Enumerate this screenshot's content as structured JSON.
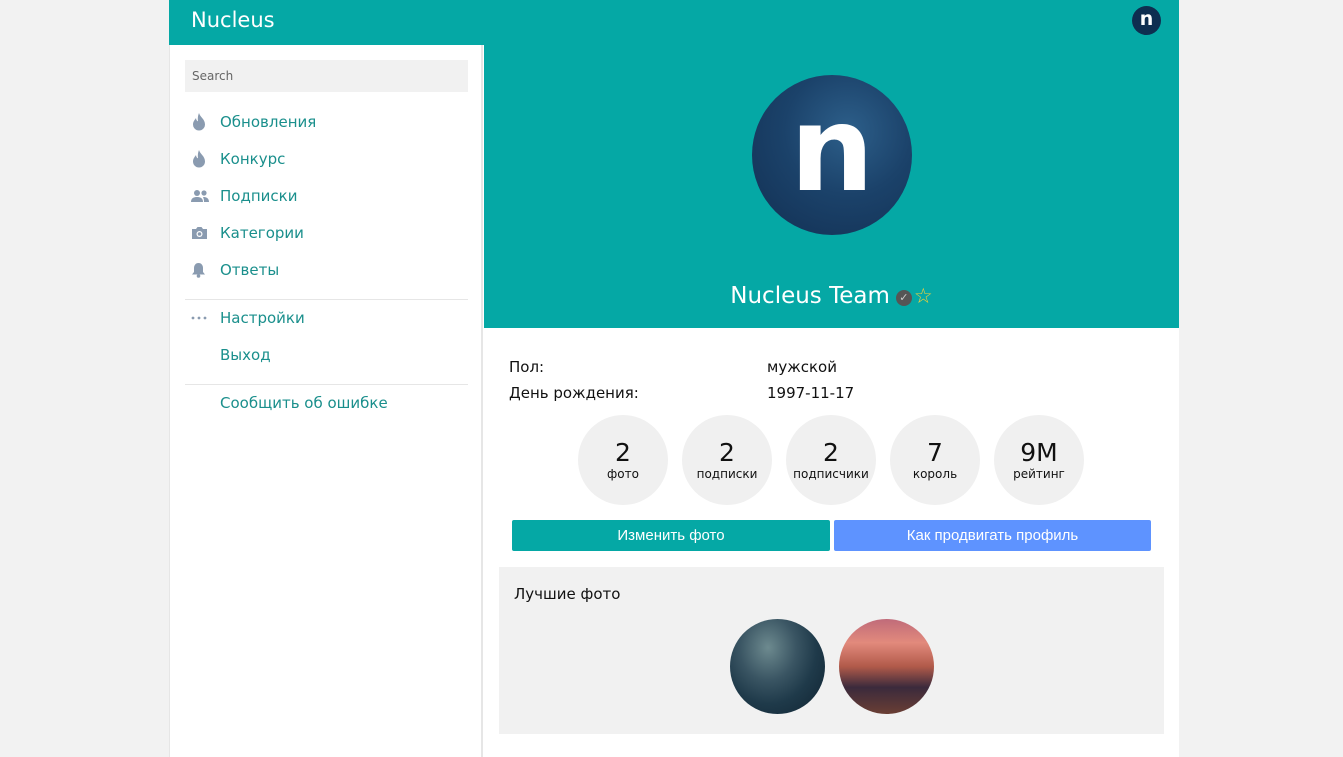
{
  "app": {
    "brand": "Nucleus",
    "avatar_letter": "n"
  },
  "sidebar": {
    "search_placeholder": "Search",
    "items": [
      {
        "label": "Обновления",
        "icon": "fire-icon"
      },
      {
        "label": "Конкурс",
        "icon": "fire-icon"
      },
      {
        "label": "Подписки",
        "icon": "people-icon"
      },
      {
        "label": "Категории",
        "icon": "camera-icon"
      },
      {
        "label": "Ответы",
        "icon": "bell-icon"
      }
    ],
    "settings_label": "Настройки",
    "logout_label": "Выход",
    "report_label": "Сообщить об ошибке"
  },
  "profile": {
    "avatar_letter": "n",
    "name": "Nucleus Team",
    "gender_label": "Пол:",
    "gender_value": "мужской",
    "birthday_label": "День рождения:",
    "birthday_value": "1997-11-17",
    "stats": [
      {
        "value": "2",
        "caption": "фото"
      },
      {
        "value": "2",
        "caption": "подписки"
      },
      {
        "value": "2",
        "caption": "подписчики"
      },
      {
        "value": "7",
        "caption": "король"
      },
      {
        "value": "9M",
        "caption": "рейтинг"
      }
    ],
    "change_photo_label": "Изменить фото",
    "promote_label": "Как продвигать профиль",
    "best_photos_title": "Лучшие фото"
  },
  "colors": {
    "accent": "#05a8a5",
    "secondary_button": "#5e93ff",
    "link": "#1a8f8c"
  }
}
